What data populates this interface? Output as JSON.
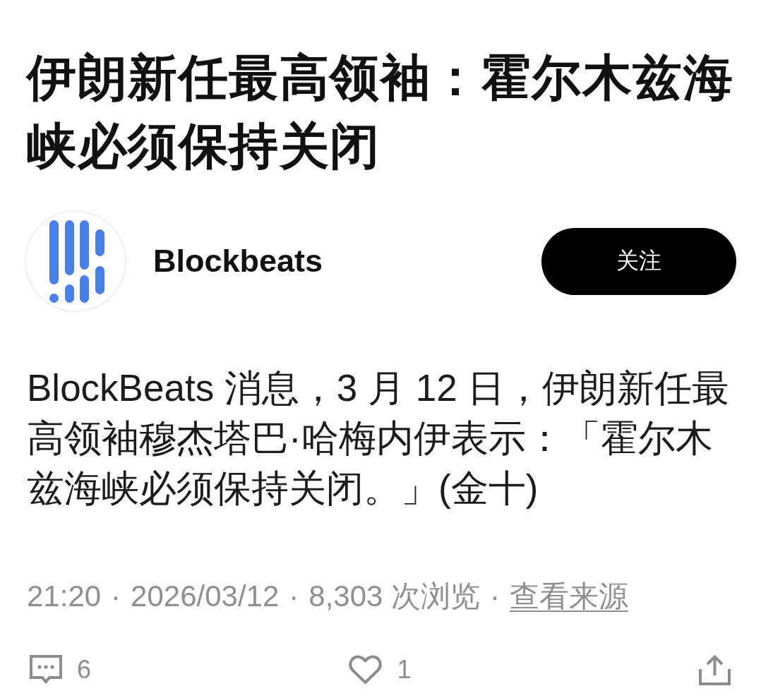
{
  "article": {
    "title": "伊朗新任最高领袖：霍尔木兹海峡必须保持关闭"
  },
  "author": {
    "name": "Blockbeats",
    "follow_button": "关注"
  },
  "body": "BlockBeats 消息，3 月 12 日，伊朗新任最高领袖穆杰塔巴·哈梅内伊表示：「霍尔木兹海峡必须保持关闭。」(金十)",
  "meta": [
    {
      "kind": "text",
      "text": "21:20"
    },
    {
      "kind": "separator",
      "text": "·"
    },
    {
      "kind": "text",
      "text": "2026/03/12"
    },
    {
      "kind": "separator",
      "text": "·"
    },
    {
      "kind": "text",
      "text": "8,303 次浏览"
    },
    {
      "kind": "separator",
      "text": "·"
    },
    {
      "kind": "link",
      "text": "查看来源"
    }
  ],
  "actions": [
    {
      "kind": "comment",
      "count": "6"
    },
    {
      "kind": "like",
      "count": "1"
    },
    {
      "kind": "share"
    }
  ]
}
